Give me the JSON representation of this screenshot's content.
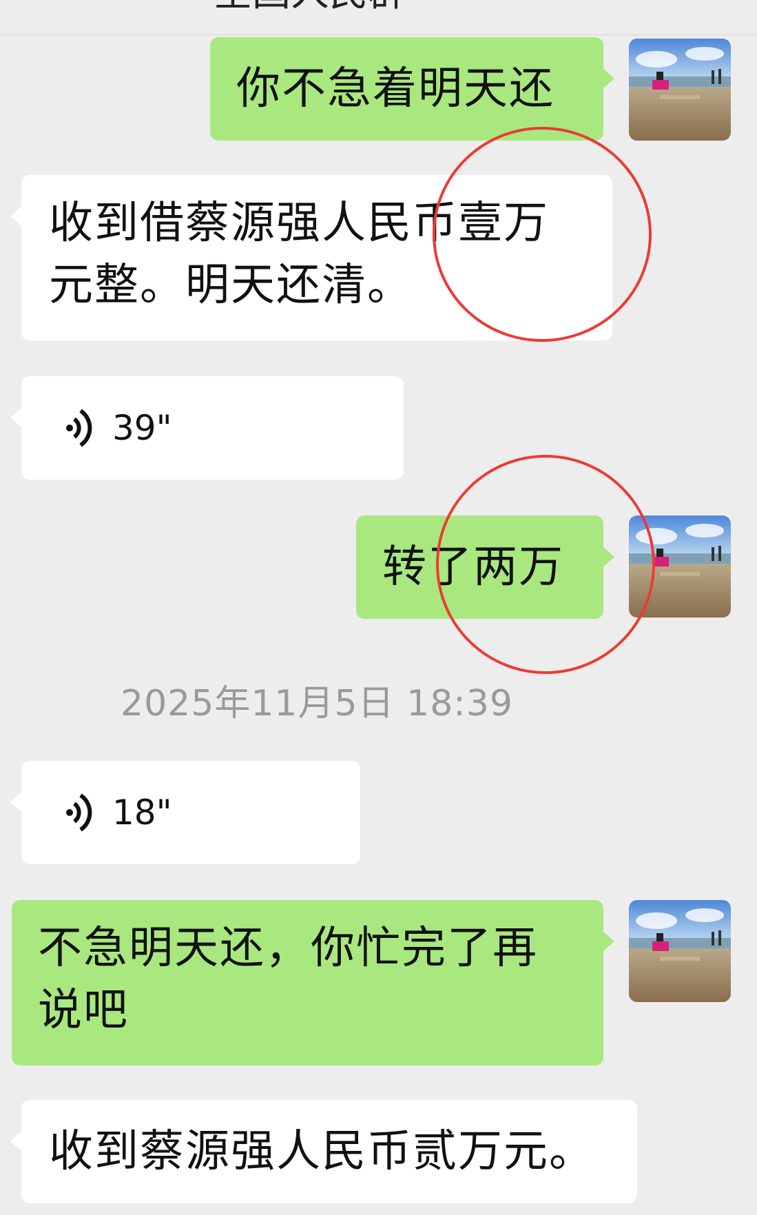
{
  "header": {
    "partial_title": "全国人民群"
  },
  "messages": [
    {
      "side": "right",
      "type": "text",
      "text": "你不急着明天还"
    },
    {
      "side": "left",
      "type": "text",
      "text": "收到借蔡源强人民币壹万元整。明天还清。"
    },
    {
      "side": "left",
      "type": "voice",
      "duration": "39\""
    },
    {
      "side": "right",
      "type": "text",
      "text": "转了两万"
    },
    {
      "side": "left",
      "type": "voice",
      "duration": "18\""
    },
    {
      "side": "right",
      "type": "text",
      "text": "不急明天还，你忙完了再说吧"
    },
    {
      "side": "left",
      "type": "text",
      "text": "收到蔡源强人民币贰万元。"
    }
  ],
  "timestamp": "2025年11月5日 18:39",
  "icons": {
    "voice": "voice-wave-icon",
    "avatar": "beach-photo-avatar"
  },
  "colors": {
    "background": "#ededed",
    "sent_bubble": "#a9e87f",
    "received_bubble": "#ffffff",
    "annotation_circle": "#ec3b32",
    "timestamp_text": "#9a9a9a"
  }
}
